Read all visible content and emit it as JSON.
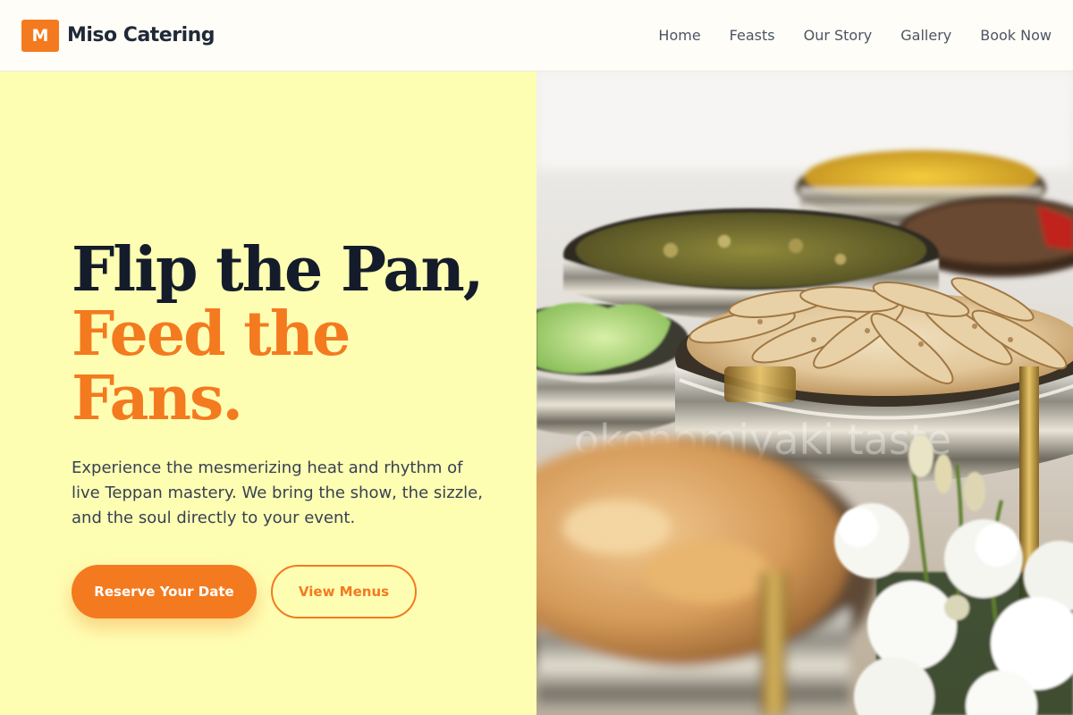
{
  "brand": {
    "logo_letter": "M",
    "name": "Miso Catering"
  },
  "nav": {
    "items": [
      "Home",
      "Feasts",
      "Our Story",
      "Gallery",
      "Book Now"
    ]
  },
  "hero": {
    "headline_line1": "Flip the Pan,",
    "headline_line2": "Feed the",
    "headline_line3": "Fans.",
    "subtext": "Experience the mesmerizing heat and rhythm of live Teppan mastery. We bring the show, the sizzle, and the soul directly to your event.",
    "primary_button": "Reserve Your Date",
    "secondary_button": "View Menus"
  },
  "image": {
    "watermark_text": "okonomiyaki taste"
  },
  "colors": {
    "accent": "#f47a1f",
    "hero_bg": "#fefeb3",
    "heading": "#141c2b",
    "nav_bg": "#fffdf7"
  }
}
